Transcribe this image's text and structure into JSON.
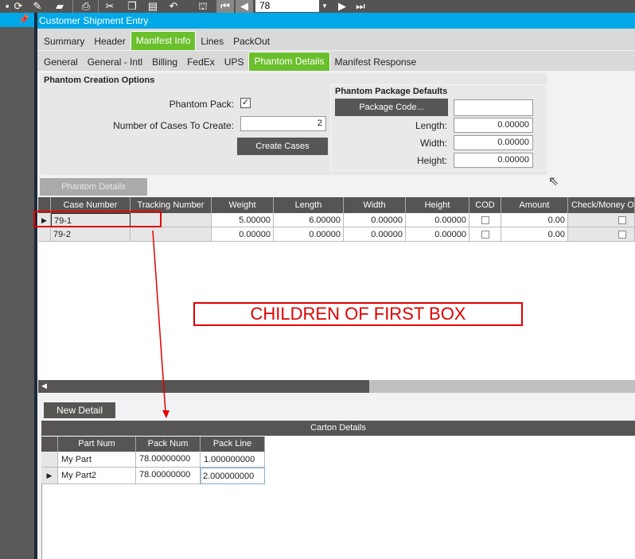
{
  "toolbar": {
    "record_value": "78",
    "icons": [
      "save-icon",
      "refresh-icon",
      "clear-icon",
      "attach-icon",
      "print-icon",
      "cut-icon",
      "copy-icon",
      "paste-icon",
      "undo-icon",
      "binoculars-icon",
      "first-icon",
      "previous-icon",
      "next-icon",
      "last-icon"
    ]
  },
  "window": {
    "title": "Customer Shipment Entry"
  },
  "tabs": [
    "Summary",
    "Header",
    "Manifest Info",
    "Lines",
    "PackOut"
  ],
  "subtabs": [
    "General",
    "General - Intl",
    "Billing",
    "FedEx",
    "UPS",
    "Phantom Details",
    "Manifest Response"
  ],
  "options": {
    "heading": "Phantom Creation Options",
    "phantom_pack_label": "Phantom Pack:",
    "cases_label": "Number of Cases To Create:",
    "cases_value": "2",
    "create_button": "Create Cases"
  },
  "defaults": {
    "heading": "Phantom Package Defaults",
    "package_code_button": "Package Code...",
    "package_code_value": "",
    "length_label": "Length:",
    "length_value": "0.00000",
    "width_label": "Width:",
    "width_value": "0.00000",
    "height_label": "Height:",
    "height_value": "0.00000"
  },
  "phantom_details_button": "Phantom Details",
  "cases_grid": {
    "columns": [
      "Case Number",
      "Tracking Number",
      "Weight",
      "Length",
      "Width",
      "Height",
      "COD",
      "Amount",
      "Check/Money O"
    ],
    "rows": [
      {
        "case": "79-1",
        "tracking": "",
        "weight": "5.00000",
        "length": "6.00000",
        "width": "0.00000",
        "height": "0.00000",
        "amount": "0.00"
      },
      {
        "case": "79-2",
        "tracking": "",
        "weight": "0.00000",
        "length": "0.00000",
        "width": "0.00000",
        "height": "0.00000",
        "amount": "0.00"
      }
    ]
  },
  "annotation": "CHILDREN OF FIRST BOX",
  "new_detail_button": "New Detail",
  "carton": {
    "title": "Carton Details",
    "columns": [
      "Part Num",
      "Pack Num",
      "Pack Line"
    ],
    "rows": [
      {
        "part": "My Part",
        "pack": "78.00000000",
        "line": "1.000000000"
      },
      {
        "part": "My Part2",
        "pack": "78.00000000",
        "line": "2.000000000"
      }
    ]
  }
}
